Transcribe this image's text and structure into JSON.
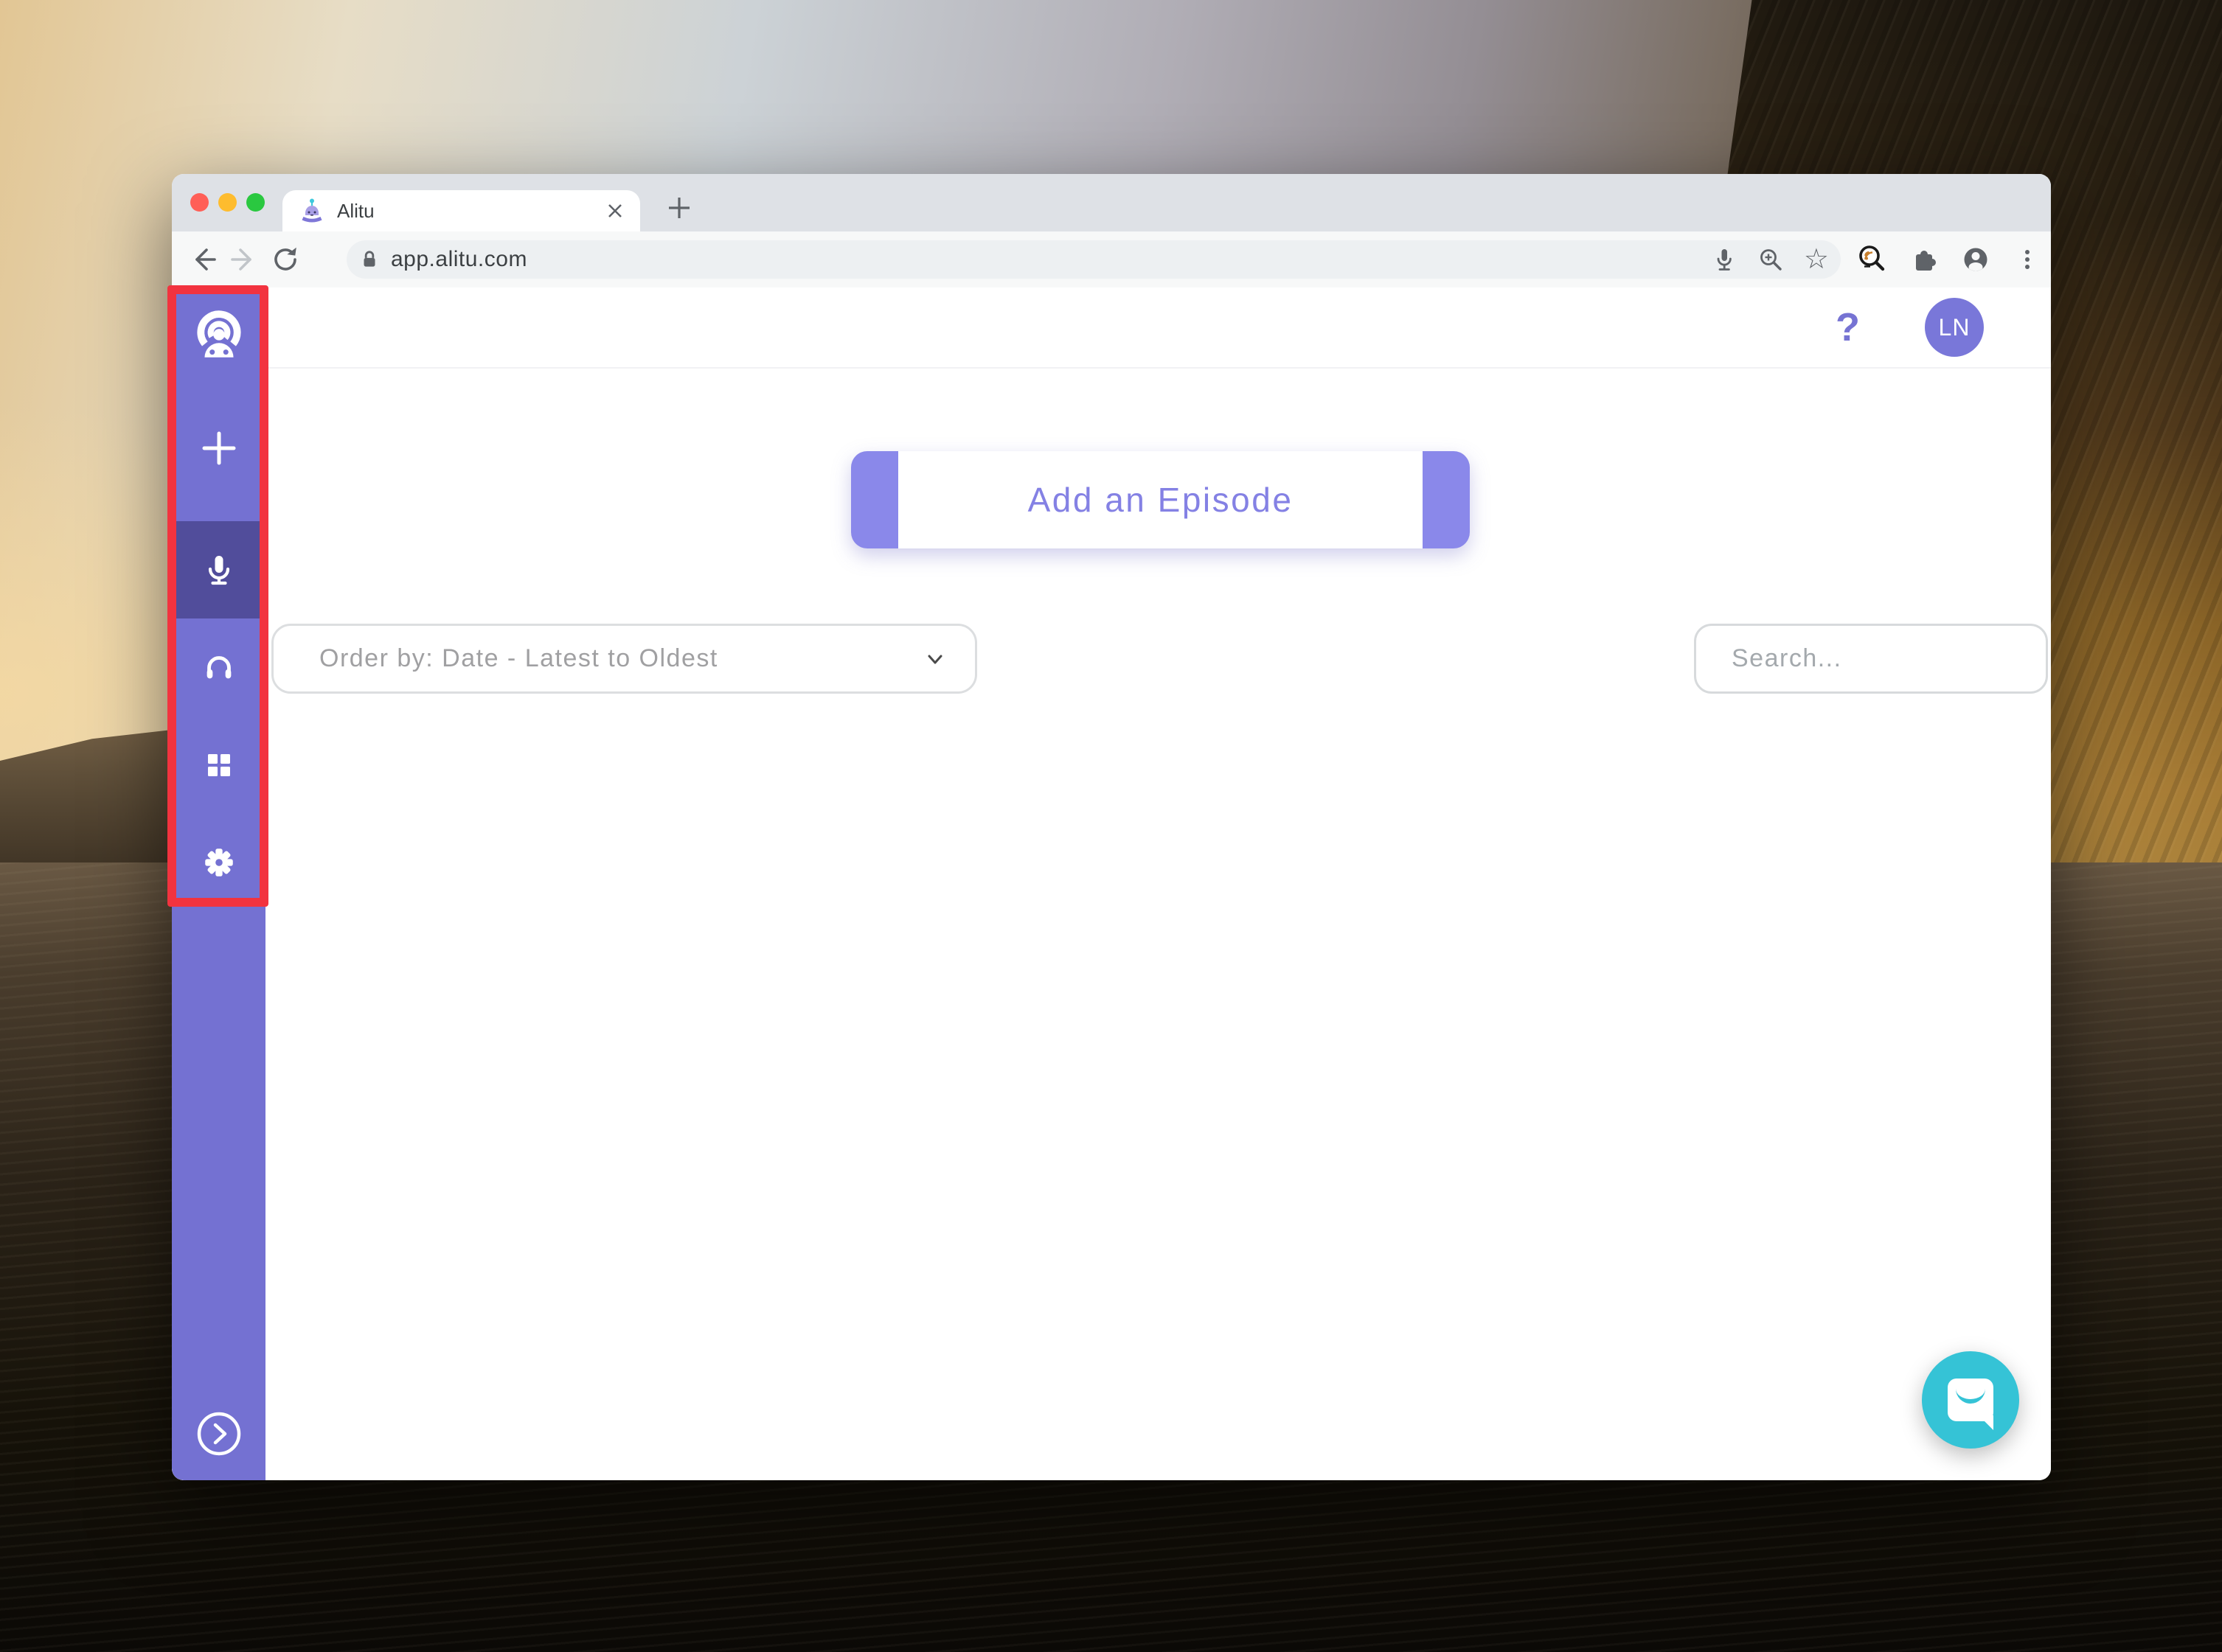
{
  "browser": {
    "window_controls": [
      "close",
      "minimize",
      "zoom"
    ],
    "tab": {
      "title": "Alitu",
      "favicon": "alitu-robot-icon"
    },
    "new_tab_label": "+",
    "url": "app.alitu.com",
    "toolbar_icons": [
      "back-icon",
      "forward-icon",
      "reload-icon",
      "lock-icon",
      "mic-icon",
      "zoom-in-icon",
      "star-icon",
      "podcast-extension-icon",
      "extensions-puzzle-icon",
      "profile-icon",
      "kebab-menu-icon"
    ],
    "star_glyph": "☆"
  },
  "app": {
    "header": {
      "help": "?",
      "avatar_initials": "LN"
    },
    "sidebar": {
      "icons": [
        "alitu-logo",
        "plus-icon",
        "microphone-icon",
        "headphones-icon",
        "grid-icon",
        "gear-icon",
        "chevron-right-icon"
      ],
      "active_item": "microphone"
    },
    "main": {
      "add_episode_label": "Add an Episode",
      "order_by_value": "Order by: Date - Latest to Oldest",
      "search_placeholder": "Search..."
    },
    "chat": {
      "icon": "intercom-messenger-icon"
    }
  },
  "annotation": {
    "type": "highlight-rectangle",
    "target": "sidebar-navigation-icons",
    "color": "#f2333f"
  },
  "colors": {
    "sidebar": "#7471d2",
    "sidebar_active": "#514d9b",
    "accent_purple": "#8481e4",
    "intercom_teal": "#35c3d6",
    "traffic_red": "#ff5f57",
    "traffic_yellow": "#febc2e",
    "traffic_green": "#2ac840"
  }
}
